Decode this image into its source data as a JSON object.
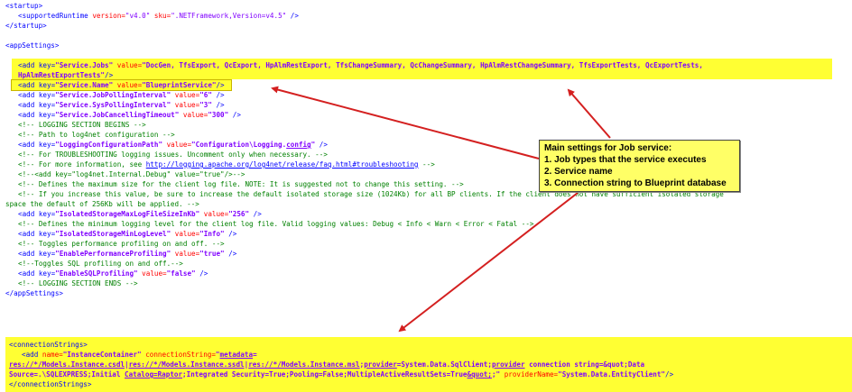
{
  "startup": {
    "open": "<startup>",
    "runtime_tag": "<supportedRuntime",
    "version_attr": "version=",
    "version_val": "\"v4.0\"",
    "sku_attr": "sku=",
    "sku_val": "\".NETFramework,Version=v4.5\"",
    "runtime_end": "/>",
    "close": "</startup>"
  },
  "app_settings": {
    "open": "<appSettings>",
    "close": "</appSettings>",
    "jobs_line1_pre": "<add key=",
    "jobs_key": "\"Service.Jobs\"",
    "jobs_value_attr": "value=",
    "jobs_value": "\"DocGen, TfsExport, QcExport, HpAlmRestExport, TfsChangeSummary, QcChangeSummary, HpAlmRestChangeSummary, TfsExportTests, QcExportTests,",
    "jobs_line2": "HpAlmRestExportTests\"",
    "jobs_line2_end": "/>",
    "name_pre": "<add key=",
    "name_key": "\"Service.Name\"",
    "name_value_attr": "value=",
    "name_value": "\"BlueprintService\"",
    "name_end": "/>",
    "polling_key": "\"Service.JobPollingInterval\"",
    "polling_value": "\"6\"",
    "syspolling_key": "\"Service.SysPollingInterval\"",
    "syspolling_value": "\"3\"",
    "cancel_key": "\"Service.JobCancellingTimeout\"",
    "cancel_value": "\"300\"",
    "c_logging_begins": "<!-- LOGGING SECTION BEGINS -->",
    "c_path_log4net": "<!-- Path to log4net configuration -->",
    "logconfig_key": "\"LoggingConfigurationPath\"",
    "logconfig_value_pre": "\"Configuration\\Logging.",
    "logconfig_value_u": "config",
    "logconfig_value_post": "\"",
    "c_troubleshooting": "<!-- For TROUBLESHOOTING logging issues. Uncomment only when necessary. -->",
    "c_more_info_pre": "<!-- For more information, see ",
    "c_more_info_link": "http://logging.apache.org/log4net/release/faq.html#troubleshooting",
    "c_more_info_post": " -->",
    "c_internal_debug": "<!--<add key=\"log4net.Internal.Debug\" value=\"true\"/>-->",
    "c_max_size": "<!-- Defines the maximum size for the client log file. NOTE: It is suggested not to change this setting. -->",
    "c_increase_1": "<!-- If you increase this value, be sure to increase the default isolated storage size (1024Kb) for all BP clients. If the client does not have sufficient isolated storage",
    "c_increase_2": "space the default of 256Kb will be applied. -->",
    "iso_key": "\"IsolatedStorageMaxLogFileSizeInKb\"",
    "iso_value": "\"256\"",
    "c_min_level": "<!-- Defines the minimum logging level for the client log file. Valid logging values: Debug < Info < Warn < Error < Fatal -->",
    "minlevel_key": "\"IsolatedStorageMinLogLevel\"",
    "minlevel_value": "\"Info\"",
    "c_perf": "<!-- Toggles performance profiling on and off. -->",
    "perf_key": "\"EnablePerformanceProfiling\"",
    "perf_value": "\"true\"",
    "c_sql": "<!--Toggles SQL profiling on and off.-->",
    "sql_key": "\"EnableSQLProfiling\"",
    "sql_value": "\"false\"",
    "c_logging_ends": "<!-- LOGGING SECTION ENDS -->",
    "add_key": "<add key=",
    "value_attr": "value=",
    "end": "/>"
  },
  "connection_strings": {
    "open": "<connectionStrings>",
    "add_pre": "<add",
    "name_attr": "name=",
    "name_val": "\"InstanceContainer\"",
    "cs_attr": "connectionString=",
    "cs_val_start": "\"",
    "metadata": "metadata",
    "equals": "=",
    "line2_res1": "res://*/Models.Instance.csdl",
    "pipe": "|",
    "line2_res2": "res://*/Models.Instance.ssdl",
    "line2_res3": "res://*/Models.Instance.msl",
    "line2_semi": ";",
    "provider1": "provider",
    "line2_provider_val": "=System.Data.SqlClient;",
    "provider2": "provider",
    "line2_tail": " connection string=&quot;Data",
    "line3_a": "Source=.\\SQLEXPRESS;Initial ",
    "catalog": "Catalog",
    "raptor": "=Raptor",
    "line3_b": ";Integrated Security=True;Pooling=False;MultipleActiveResultSets=True",
    "quot": "&quot;",
    "line3_c": ";\"",
    "pn_attr": "providerName=",
    "pn_val": "\"System.Data.EntityClient\"",
    "end": "/>",
    "close": "</connectionStrings>"
  },
  "note": {
    "title": "Main settings for Job service:",
    "items": [
      "1. Job types that the service executes",
      "2. Service name",
      "3. Connection string to Blueprint database"
    ]
  },
  "colors": {
    "highlight": "#ffff33",
    "tag": "#0000ff",
    "attribute": "#ff0000",
    "value": "#8000ff",
    "comment": "#008000",
    "arrow": "#d42020",
    "note_bg": "#ffff66"
  }
}
